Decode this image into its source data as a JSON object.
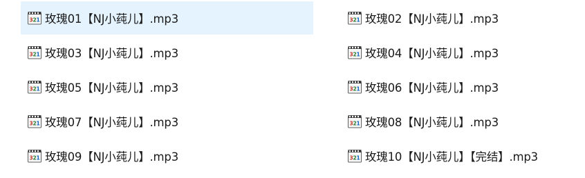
{
  "files": [
    {
      "name": "玫瑰01【NJ小莼儿】.mp3",
      "icon": "media-player-classic-icon",
      "selected": true
    },
    {
      "name": "玫瑰02【NJ小莼儿】.mp3",
      "icon": "media-player-classic-icon",
      "selected": false
    },
    {
      "name": "玫瑰03【NJ小莼儿】.mp3",
      "icon": "media-player-classic-icon",
      "selected": false
    },
    {
      "name": "玫瑰04【NJ小莼儿】.mp3",
      "icon": "media-player-classic-icon",
      "selected": false
    },
    {
      "name": "玫瑰05【NJ小莼儿】.mp3",
      "icon": "media-player-classic-icon",
      "selected": false
    },
    {
      "name": "玫瑰06【NJ小莼儿】.mp3",
      "icon": "media-player-classic-icon",
      "selected": false
    },
    {
      "name": "玫瑰07【NJ小莼儿】.mp3",
      "icon": "media-player-classic-icon",
      "selected": false
    },
    {
      "name": "玫瑰08【NJ小莼儿】.mp3",
      "icon": "media-player-classic-icon",
      "selected": false
    },
    {
      "name": "玫瑰09【NJ小莼儿】.mp3",
      "icon": "media-player-classic-icon",
      "selected": false
    },
    {
      "name": "玫瑰10【NJ小莼儿】【完结】.mp3",
      "icon": "media-player-classic-icon",
      "selected": false
    }
  ],
  "colors": {
    "selection_background": "#e5f3ff",
    "text": "#1a1a1a"
  }
}
